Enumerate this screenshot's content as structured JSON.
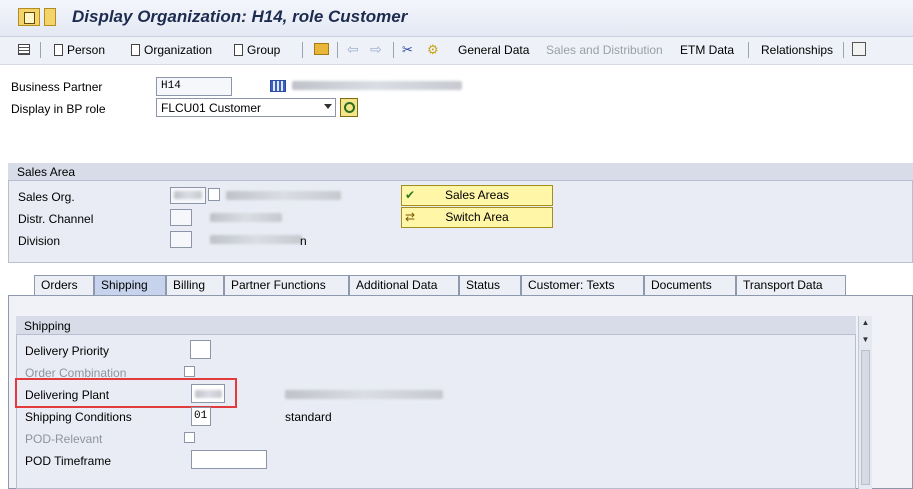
{
  "title": "Display Organization: H14, role Customer",
  "toolbar": {
    "person": "Person",
    "organization": "Organization",
    "group": "Group",
    "general_data": "General Data",
    "sales_distribution": "Sales and Distribution",
    "etm_data": "ETM Data",
    "relationships": "Relationships"
  },
  "header": {
    "bp_label": "Business Partner",
    "bp_value": "H14",
    "role_label": "Display in BP role",
    "role_value": "FLCU01 Customer"
  },
  "sales_area": {
    "title": "Sales Area",
    "org_label": "Sales Org.",
    "channel_label": "Distr. Channel",
    "division_label": "Division",
    "sales_areas_button": "Sales Areas",
    "switch_area_button": "Switch Area",
    "division_suffix": "n"
  },
  "tabs": [
    "Orders",
    "Shipping",
    "Billing",
    "Partner Functions",
    "Additional Data",
    "Status",
    "Customer: Texts",
    "Documents",
    "Transport Data"
  ],
  "shipping": {
    "title": "Shipping",
    "delivery_priority": "Delivery Priority",
    "order_combination": "Order Combination",
    "delivering_plant": "Delivering Plant",
    "shipping_conditions": "Shipping Conditions",
    "shipping_conditions_value": "01",
    "shipping_conditions_desc": "standard",
    "pod_relevant": "POD-Relevant",
    "pod_timeframe": "POD Timeframe"
  },
  "colors": {
    "highlight": "#e23b3b",
    "button_yellow": "#fff6a8",
    "title_text": "#1d2b4f"
  }
}
